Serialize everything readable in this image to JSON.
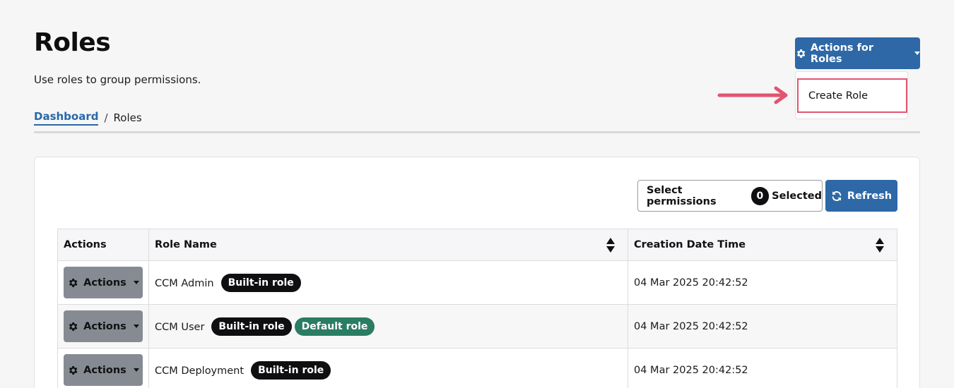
{
  "header": {
    "title": "Roles",
    "subtitle": "Use roles to group permissions."
  },
  "breadcrumb": {
    "link": "Dashboard",
    "separator": "/",
    "current": "Roles"
  },
  "actions_menu": {
    "button_label": "Actions for Roles",
    "icon": "gear-icon",
    "items": [
      {
        "label": "Create Role"
      }
    ]
  },
  "toolbar": {
    "select_permissions_label": "Select permissions",
    "selected_count": "0",
    "selected_label": "Selected",
    "refresh_label": "Refresh",
    "refresh_icon": "refresh-icon"
  },
  "table": {
    "columns": [
      "Actions",
      "Role Name",
      "Creation Date Time"
    ],
    "rows": [
      {
        "action_label": "Actions",
        "role_name": "CCM Admin",
        "badges": [
          "Built-in role"
        ],
        "created": "04 Mar 2025 20:42:52"
      },
      {
        "action_label": "Actions",
        "role_name": "CCM User",
        "badges": [
          "Built-in role",
          "Default role"
        ],
        "created": "04 Mar 2025 20:42:52"
      },
      {
        "action_label": "Actions",
        "role_name": "CCM Deployment",
        "badges": [
          "Built-in role"
        ],
        "created": "04 Mar 2025 20:42:52"
      }
    ]
  },
  "colors": {
    "primary": "#2e68a6",
    "highlight": "#e25470",
    "badge_dark": "#0f0f12",
    "badge_green": "#2a7c62",
    "secondary_button": "#868b93"
  }
}
